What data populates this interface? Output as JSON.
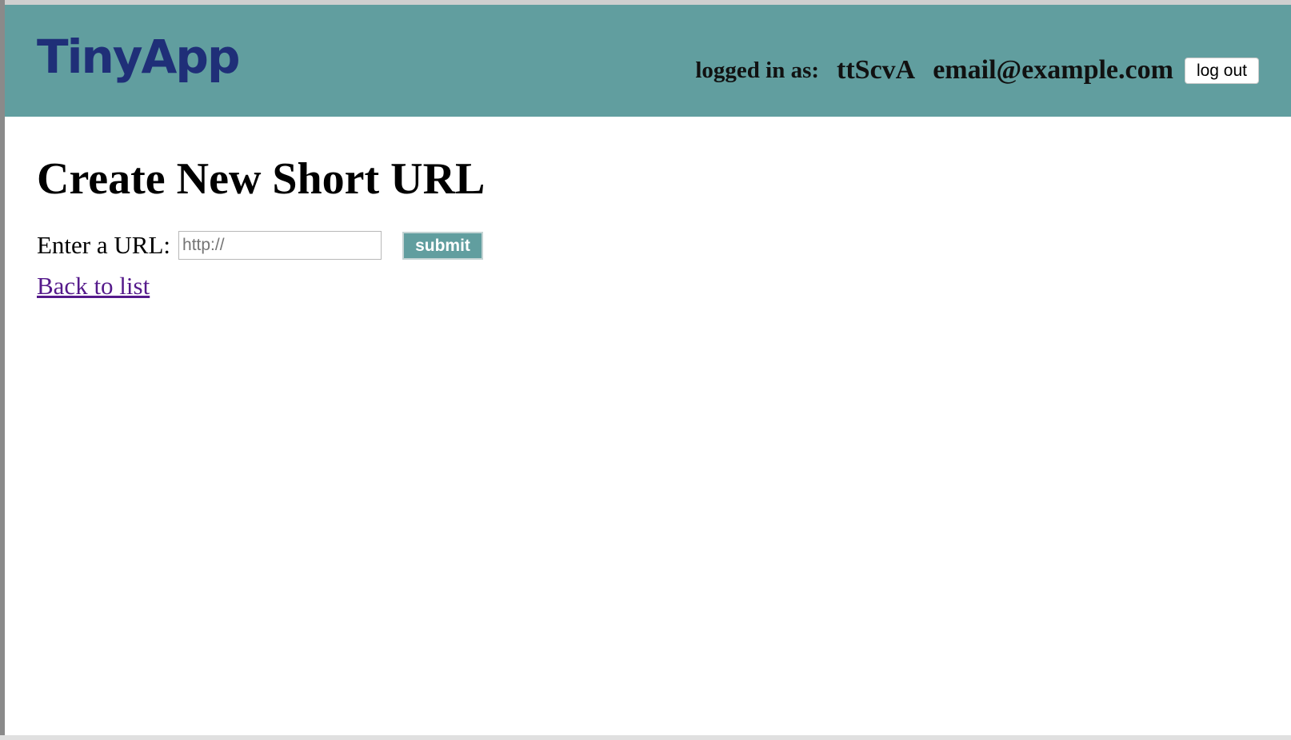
{
  "header": {
    "logo": "TinyApp",
    "logged_in_label": "logged in as:",
    "user_id": "ttScvA",
    "user_email": "email@example.com",
    "logout_label": "log out"
  },
  "main": {
    "title": "Create New Short URL",
    "url_label": "Enter a URL:",
    "url_placeholder": "http://",
    "submit_label": "submit",
    "back_link": "Back to list"
  },
  "colors": {
    "header_bg": "#619e9f",
    "logo": "#1f2f78",
    "link_visited": "#551a8b"
  }
}
